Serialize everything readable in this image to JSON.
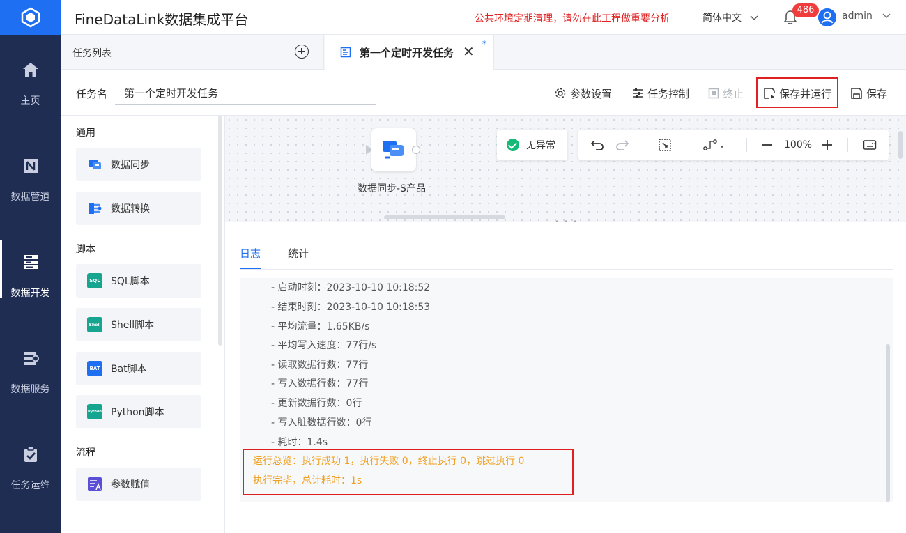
{
  "app": {
    "title": "FineDataLink数据集成平台",
    "notice": "公共环境定期清理，请勿在此工程做重要分析",
    "language": "简体中文",
    "notification_count": "486",
    "user": "admin"
  },
  "nav": {
    "items": [
      {
        "label": "主页",
        "icon": "home-icon"
      },
      {
        "label": "数据管道",
        "icon": "pipeline-icon"
      },
      {
        "label": "数据开发",
        "icon": "data-dev-icon",
        "active": true
      },
      {
        "label": "数据服务",
        "icon": "data-service-icon"
      },
      {
        "label": "任务运维",
        "icon": "task-ops-icon"
      }
    ]
  },
  "tabs": {
    "list_label": "任务列表",
    "active_label": "第一个定时开发任务",
    "modified_marker": "*"
  },
  "task": {
    "name_label": "任务名",
    "name_value": "第一个定时开发任务",
    "buttons": {
      "params": "参数设置",
      "control": "任务控制",
      "stop": "终止",
      "save_run": "保存并运行",
      "save": "保存"
    }
  },
  "panel": {
    "sections": [
      {
        "title": "通用",
        "items": [
          "数据同步",
          "数据转换"
        ]
      },
      {
        "title": "脚本",
        "items": [
          "SQL脚本",
          "Shell脚本",
          "Bat脚本",
          "Python脚本"
        ]
      },
      {
        "title": "流程",
        "items": [
          "参数赋值"
        ]
      }
    ],
    "icon_texts": {
      "sql": "SQL",
      "shell": "Shell",
      "bat": "BAT",
      "python": "Python"
    }
  },
  "canvas": {
    "node_label": "数据同步-S产品",
    "status": "无异常",
    "zoom": "100%"
  },
  "log": {
    "tabs": [
      "日志",
      "统计"
    ],
    "lines": [
      "- 启动时刻：2023-10-10 10:18:52",
      "- 结束时刻：2023-10-10 10:18:53",
      "- 平均流量：1.65KB/s",
      "- 平均写入速度：77行/s",
      "- 读取数据行数：77行",
      "- 写入数据行数：77行",
      "- 更新数据行数：0行",
      "- 写入脏数据行数：0行",
      "- 耗时：1.4s"
    ],
    "summary": [
      "运行总览：执行成功 1，执行失败 0，终止执行 0，跳过执行 0",
      "执行完毕，总计耗时：1s"
    ]
  },
  "colors": {
    "brand": "#1e6ff1",
    "nav_bg": "#1f2d53",
    "alert": "#e02020",
    "success": "#17b978",
    "summary_text": "#f0a020"
  }
}
